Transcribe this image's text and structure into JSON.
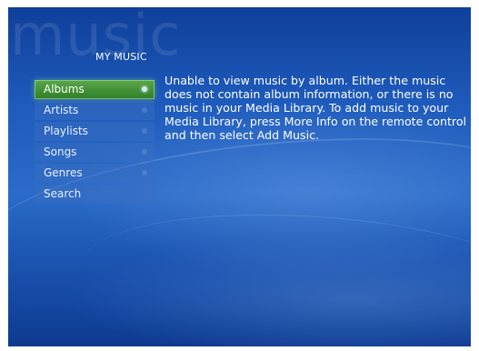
{
  "background_word": "music",
  "section_title": "MY MUSIC",
  "menu": {
    "items": [
      {
        "label": "Albums"
      },
      {
        "label": "Artists"
      },
      {
        "label": "Playlists"
      },
      {
        "label": "Songs"
      },
      {
        "label": "Genres"
      },
      {
        "label": "Search"
      }
    ],
    "focused_label": "Albums"
  },
  "message": "Unable to view music by album. Either the music does not contain album information, or there is no music in your Media Library. To add music to your Media Library, press More Info on the remote control and then select Add Music.",
  "colors": {
    "background_blue": "#1f5cbd",
    "focus_green": "#2f7d26",
    "text": "#ffffff"
  }
}
